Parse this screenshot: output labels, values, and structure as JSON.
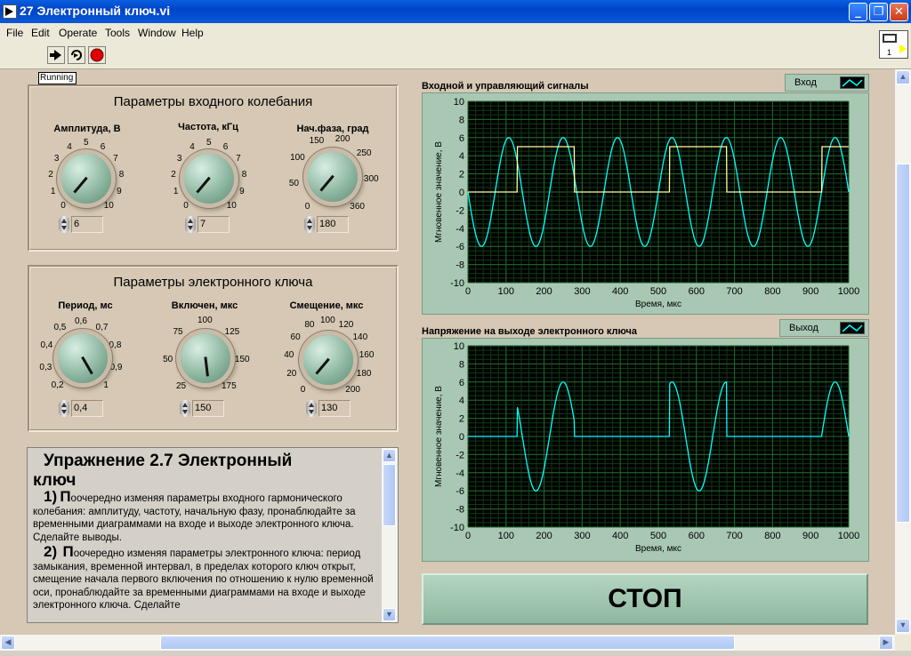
{
  "window": {
    "title": "27 Электронный ключ.vi",
    "minimize": "_",
    "restore": "❐",
    "close": "✕"
  },
  "menu": [
    "File",
    "Edit",
    "Operate",
    "Tools",
    "Window",
    "Help"
  ],
  "status": {
    "running": "Running"
  },
  "input_params": {
    "title": "Параметры входного колебания",
    "amplitude": {
      "label": "Амплитуда, В",
      "value": "6",
      "ticks": [
        "0",
        "1",
        "2",
        "3",
        "4",
        "5",
        "6",
        "7",
        "8",
        "9",
        "10"
      ]
    },
    "frequency": {
      "label": "Частота, кГц",
      "value": "7",
      "ticks": [
        "0",
        "1",
        "2",
        "3",
        "4",
        "5",
        "6",
        "7",
        "8",
        "9",
        "10"
      ]
    },
    "phase": {
      "label": "Нач.фаза, град",
      "value": "180",
      "ticks": [
        "0",
        "50",
        "100",
        "150",
        "200",
        "250",
        "300",
        "360"
      ]
    }
  },
  "key_params": {
    "title": "Параметры электронного ключа",
    "period": {
      "label": "Период, мс",
      "value": "0,4",
      "ticks": [
        "0,2",
        "0,3",
        "0,4",
        "0,5",
        "0,6",
        "0,7",
        "0,8",
        "0,9",
        "1"
      ]
    },
    "on_time": {
      "label": "Включен, мкс",
      "value": "150",
      "ticks": [
        "25",
        "50",
        "75",
        "100",
        "125",
        "150",
        "175"
      ]
    },
    "offset": {
      "label": "Смещение, мкс",
      "value": "130",
      "ticks": [
        "0",
        "20",
        "40",
        "60",
        "80",
        "100",
        "120",
        "140",
        "160",
        "180",
        "200"
      ]
    }
  },
  "notes": {
    "heading_line1": "Упражнение 2.7 Электронный",
    "heading_line2": "ключ",
    "item1_num": "1)",
    "item1_cap": "П",
    "item1_text": "оочередно изменяя параметры входного гармонического колебания: амплитуду, частоту, начальную фазу, пронаблюдайте за временными диаграммами на входе и выходе электронного ключа. Сделайте выводы.",
    "item2_num": "2)",
    "item2_cap": "П",
    "item2_text": "оочередно изменяя параметры электронного ключа: период замыкания, временной интервал, в пределах которого ключ открыт, смещение начала первого включения по отношению к нулю временной оси,  пронаблюдайте за временными диаграммами на входе и выходе электронного ключа. Сделайте"
  },
  "stop_button": "СТОП",
  "colors": {
    "panel": "#d6c8b4",
    "graph_frame": "#a8c8b4",
    "plot_bg": "#000000",
    "grid": "#1f6a2a",
    "signal": "#00ffff",
    "control": "#ffffa0"
  },
  "graph1": {
    "title": "Входной и управляющий сигналы",
    "legend": "Вход"
  },
  "graph2": {
    "title": "Напряжение на выходе электронного ключа",
    "legend": "Выход"
  },
  "chart_data": [
    {
      "type": "line",
      "title": "Входной и управляющий сигналы",
      "xlabel": "Время, мкс",
      "ylabel": "Мгновенное значение, В",
      "xlim": [
        0,
        1000
      ],
      "ylim": [
        -10,
        10
      ],
      "xticks": [
        "0",
        "100",
        "200",
        "300",
        "400",
        "500",
        "600",
        "700",
        "800",
        "900",
        "1000"
      ],
      "yticks": [
        "10",
        "8",
        "6",
        "4",
        "2",
        "0",
        "-2",
        "-4",
        "-6",
        "-8",
        "-10"
      ],
      "grid": true,
      "series": [
        {
          "name": "Вход",
          "kind": "sine",
          "amplitude": 6,
          "frequency_khz": 7,
          "phase_deg": 180
        },
        {
          "kind": "control",
          "high": 5,
          "low": 0,
          "period_us": 400,
          "on_us": 150,
          "offset_us": 130
        }
      ]
    },
    {
      "type": "line",
      "title": "Напряжение на выходе электронного ключа",
      "xlabel": "Время, мкс",
      "ylabel": "Мгновенное значение, В",
      "xlim": [
        0,
        1000
      ],
      "ylim": [
        -10,
        10
      ],
      "xticks": [
        "0",
        "100",
        "200",
        "300",
        "400",
        "500",
        "600",
        "700",
        "800",
        "900",
        "1000"
      ],
      "yticks": [
        "10",
        "8",
        "6",
        "4",
        "2",
        "0",
        "-2",
        "-4",
        "-6",
        "-8",
        "-10"
      ],
      "grid": true,
      "series": [
        {
          "name": "Выход",
          "kind": "gated_sine",
          "amplitude": 6,
          "frequency_khz": 7,
          "phase_deg": 180,
          "period_us": 400,
          "on_us": 150,
          "offset_us": 130
        }
      ]
    }
  ]
}
